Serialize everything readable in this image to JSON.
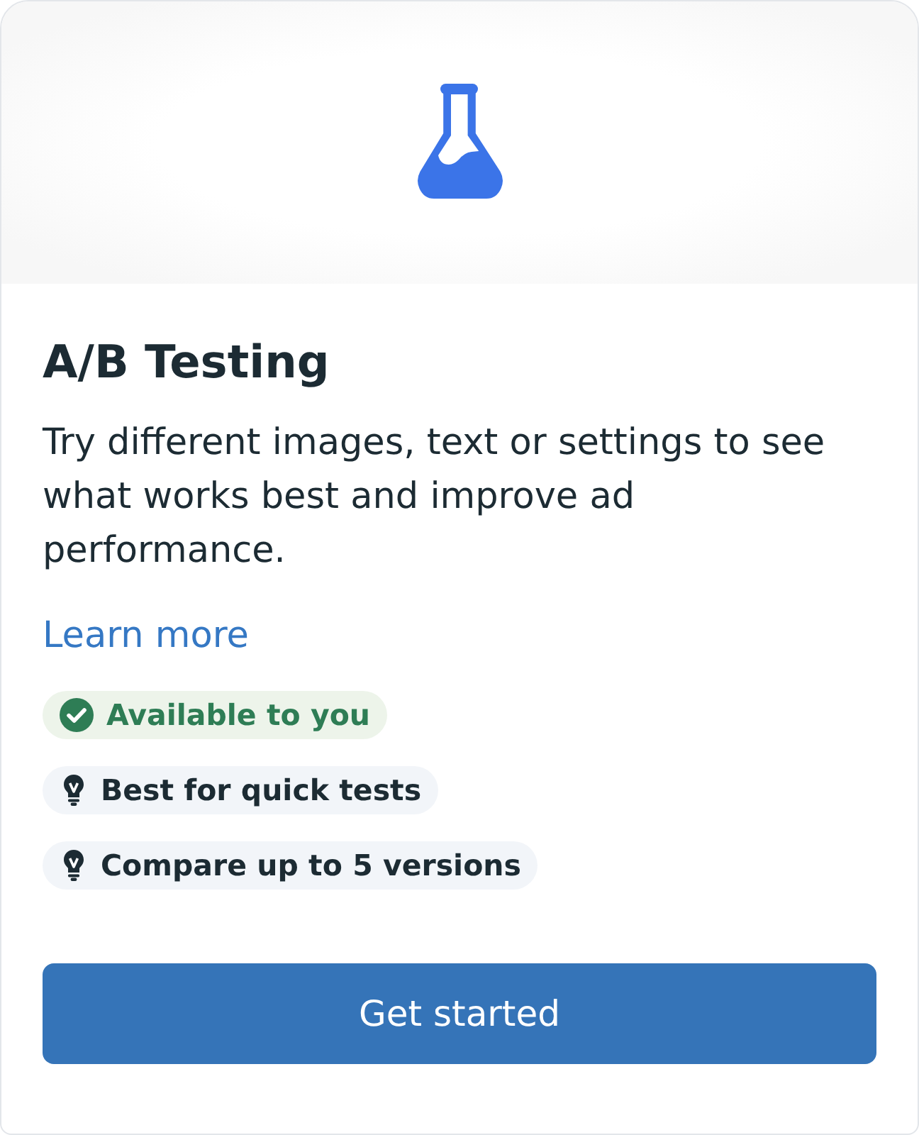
{
  "card": {
    "title": "A/B Testing",
    "description": "Try different images, text or settings to see what works best and improve ad performance.",
    "link": "Learn more",
    "tags": [
      {
        "kind": "status",
        "label": "Available to you"
      },
      {
        "kind": "tip",
        "label": "Best for quick tests"
      },
      {
        "kind": "tip",
        "label": "Compare up to 5 versions"
      }
    ],
    "button": "Get started"
  }
}
